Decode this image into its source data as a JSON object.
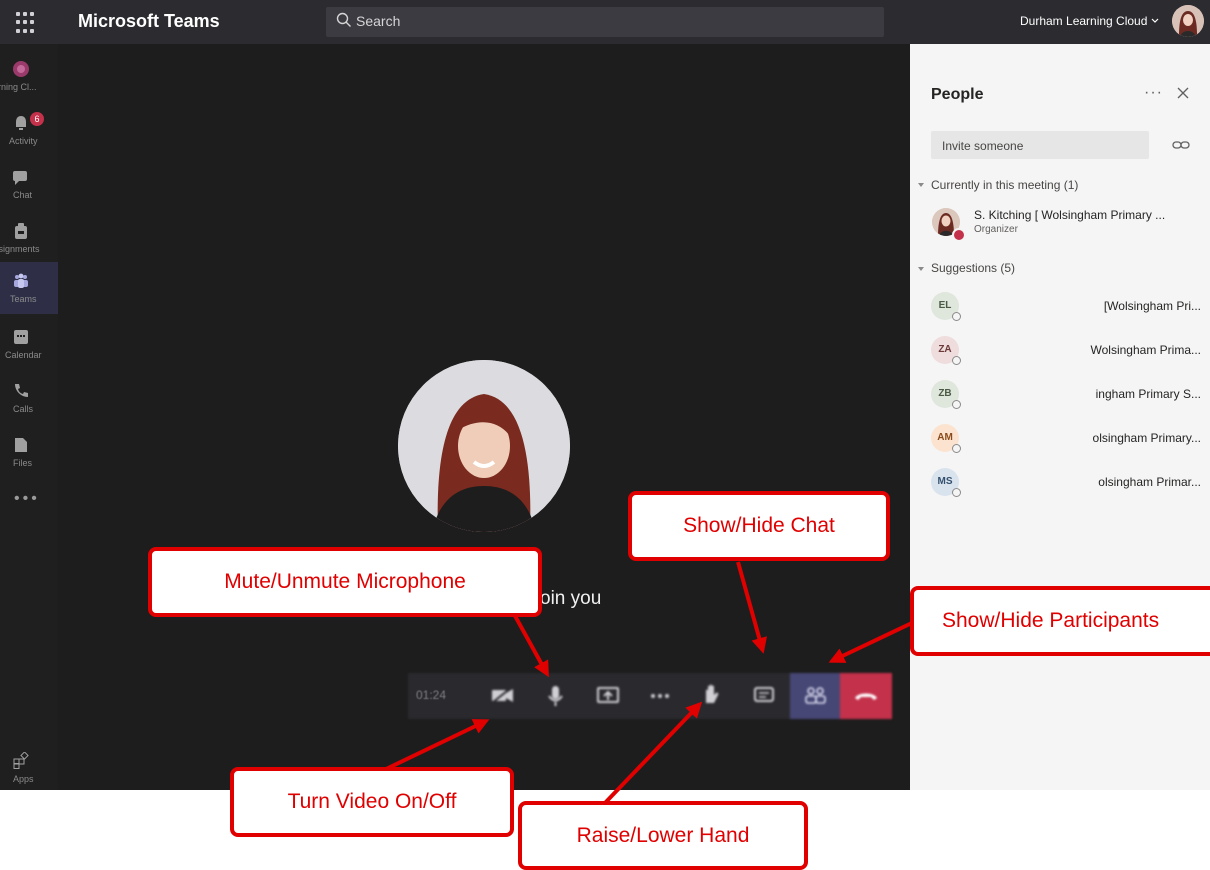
{
  "app": {
    "title": "Microsoft Teams",
    "search_placeholder": "Search",
    "org_name": "Durham Learning Cloud"
  },
  "rail": {
    "items": [
      {
        "label": "rning Cl..."
      },
      {
        "label": "Activity"
      },
      {
        "label": "Chat",
        "badge": "6"
      },
      {
        "label": "ssignments"
      },
      {
        "label": "Teams"
      },
      {
        "label": "Calendar"
      },
      {
        "label": "Calls"
      },
      {
        "label": "Files"
      },
      {
        "label": "Apps"
      }
    ]
  },
  "stage": {
    "waiting_text": "oin you",
    "timer": "01:24"
  },
  "people_panel": {
    "title": "People",
    "invite_placeholder": "Invite someone",
    "current_section": "Currently in this meeting (1)",
    "organizer": {
      "name": "S. Kitching [ Wolsingham Primary ...",
      "role": "Organizer"
    },
    "suggestions_section": "Suggestions (5)",
    "suggestions": [
      {
        "initials": "EL",
        "name": "[Wolsingham Pri...",
        "bg": "#dfe6dc",
        "fg": "#4a5a45"
      },
      {
        "initials": "ZA",
        "name": "Wolsingham Prima...",
        "bg": "#efdcdc",
        "fg": "#6b3a3a"
      },
      {
        "initials": "ZB",
        "name": "ingham Primary S...",
        "bg": "#dfe6dc",
        "fg": "#4a5a45"
      },
      {
        "initials": "AM",
        "name": "olsingham Primary...",
        "bg": "#fbe3cf",
        "fg": "#8a4b1c"
      },
      {
        "initials": "MS",
        "name": "olsingham Primar...",
        "bg": "#d8e3ee",
        "fg": "#34506e"
      }
    ]
  },
  "annotations": {
    "show_hide_chat": "Show/Hide Chat",
    "mute_unmute": "Mute/Unmute Microphone",
    "show_hide_participants": "Show/Hide Participants",
    "turn_video": "Turn Video On/Off",
    "raise_lower_hand": "Raise/Lower Hand"
  },
  "colors": {
    "annotation_red": "#e00000",
    "hangup_red": "#c4314b",
    "participants_active": "#464775",
    "topbar": "#2b2b30"
  }
}
